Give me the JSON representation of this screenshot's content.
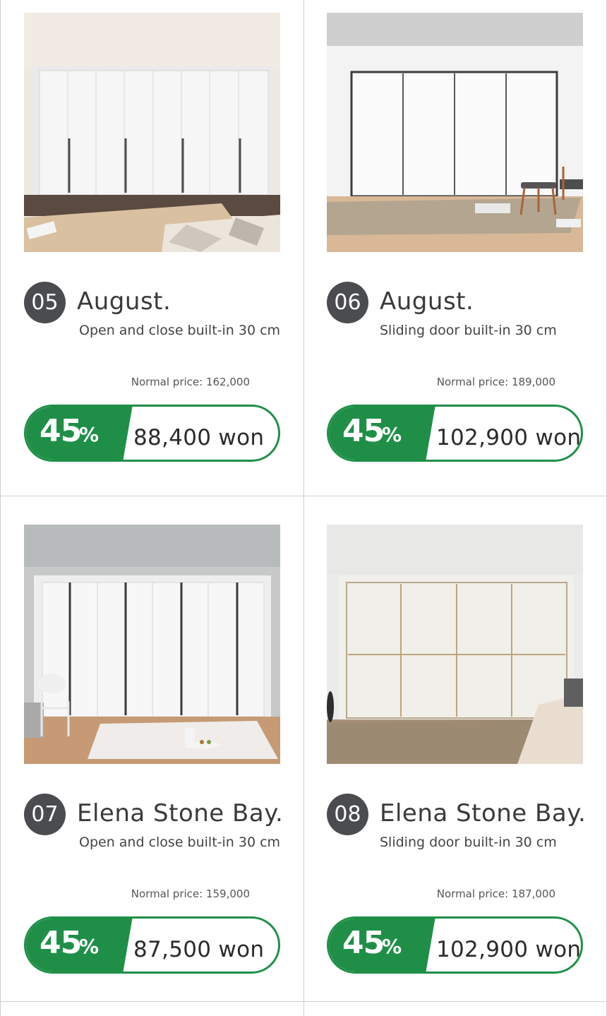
{
  "colors": {
    "accent": "#1f8f48",
    "badge": "#4a4c50",
    "divider": "#cfcfcf"
  },
  "products": [
    {
      "number": "05",
      "name": "August.",
      "subtitle": "Open and close built-in 30 cm",
      "normal_price": "Normal price: 162,000",
      "discount_num": "45",
      "discount_sym": "%",
      "sale_price": "88,400 won",
      "image": "white hinged-door built-in wardrobe with black handles in living room"
    },
    {
      "number": "06",
      "name": "August.",
      "subtitle": "Sliding door built-in 30 cm",
      "normal_price": "Normal price: 189,000",
      "discount_num": "45",
      "discount_sym": "%",
      "sale_price": "102,900 won",
      "image": "white sliding-door built-in wardrobe with wooden chair and rug"
    },
    {
      "number": "07",
      "name": "Elena Stone Bay.",
      "subtitle": "Open and close built-in 30 cm",
      "normal_price": "Normal price: 159,000",
      "discount_num": "45",
      "discount_sym": "%",
      "sale_price": "87,500 won",
      "image": "white hinged-door built-in wardrobe with grey wall and white rug"
    },
    {
      "number": "08",
      "name": "Elena Stone Bay.",
      "subtitle": "Sliding door built-in 30 cm",
      "normal_price": "Normal price: 187,000",
      "discount_num": "45",
      "discount_sym": "%",
      "sale_price": "102,900 won",
      "image": "cream sliding-door built-in wardrobe with shaggy rug"
    }
  ]
}
